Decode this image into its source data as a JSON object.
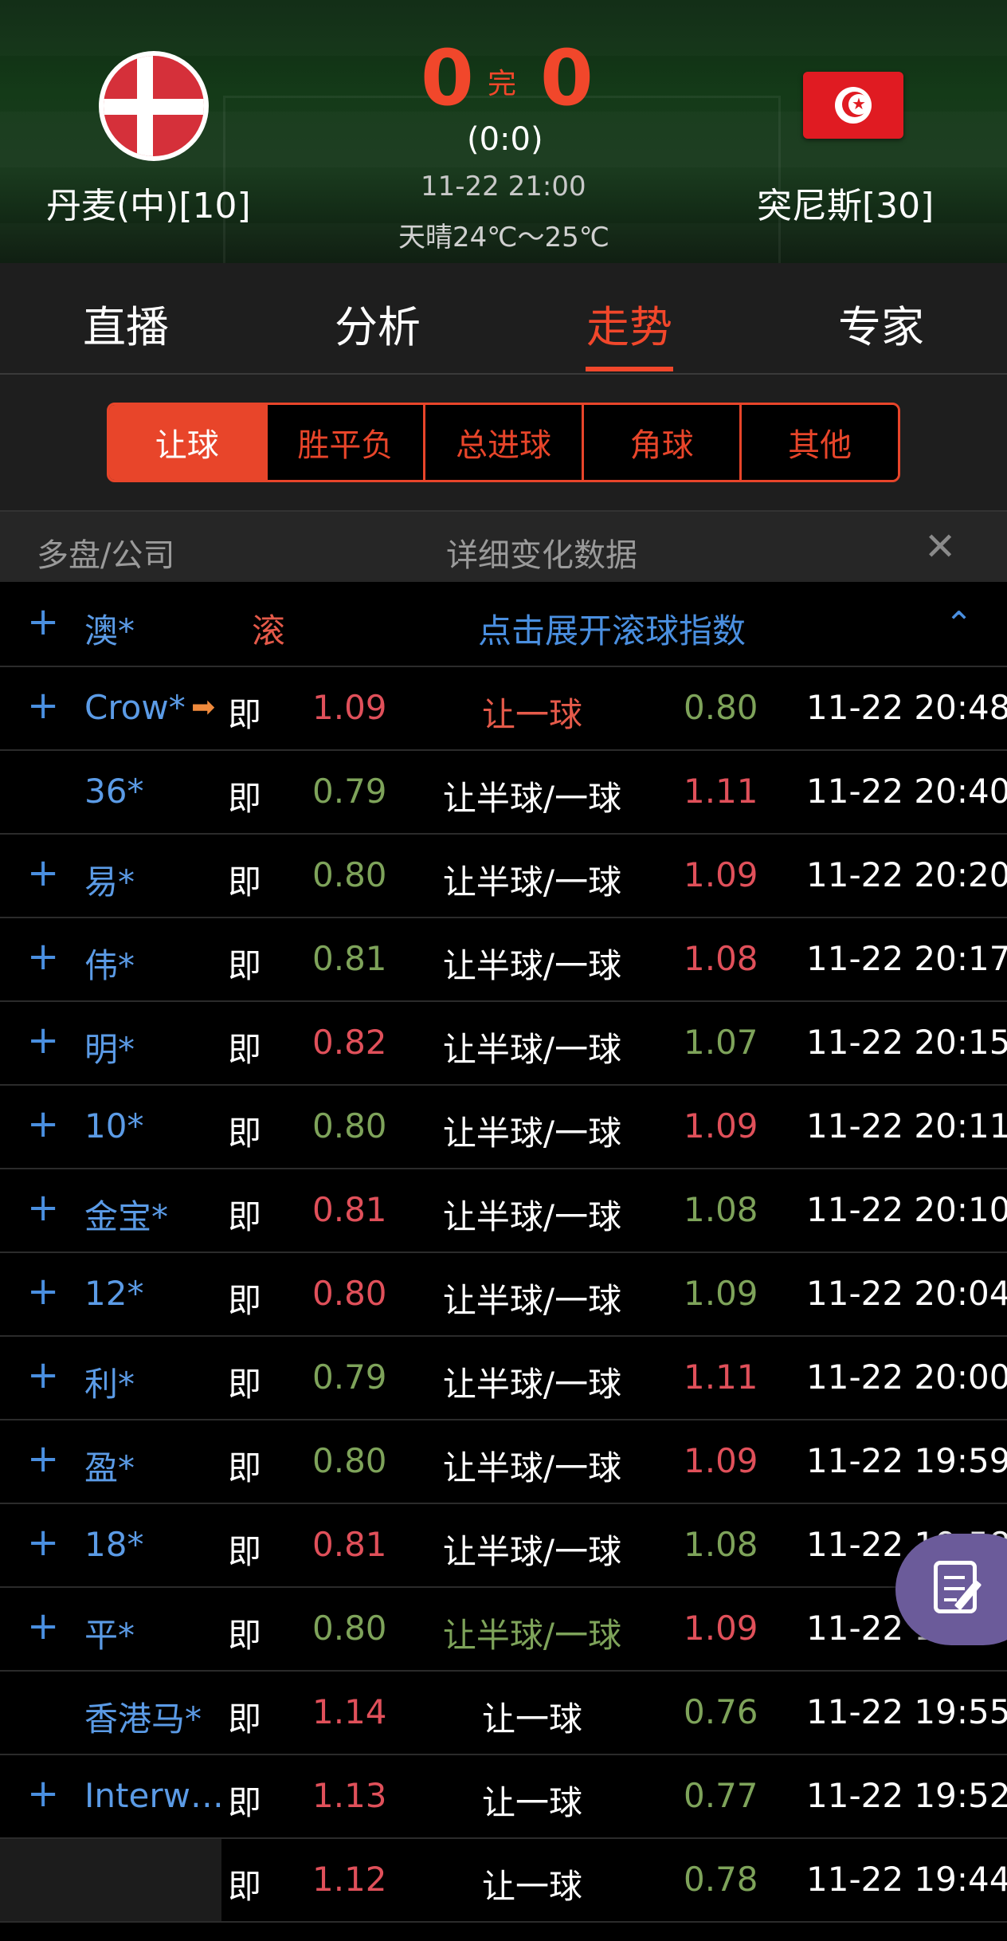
{
  "match": {
    "home_team": "丹麦(中)[10]",
    "away_team": "突尼斯[30]",
    "home_score": "0",
    "away_score": "0",
    "status": "完",
    "halftime": "(0:0)",
    "datetime": "11-22 21:00",
    "weather": "天晴24℃～25℃"
  },
  "tabs": [
    "直播",
    "分析",
    "走势",
    "专家"
  ],
  "active_tab": "走势",
  "filters": [
    "让球",
    "胜平负",
    "总进球",
    "角球",
    "其他"
  ],
  "active_filter": "让球",
  "table_header": {
    "company": "多盘/公司",
    "detail": "详细变化数据",
    "close": "✕"
  },
  "live_row": {
    "plus": "+",
    "company": "澳*",
    "live_tag": "滚",
    "expand_text": "点击展开滚球指数",
    "caret": "⌃"
  },
  "rows": [
    {
      "plus": "+",
      "company": "Crow*",
      "arrow": "➡",
      "tag": "即",
      "home": "1.09",
      "home_color": "red",
      "handicap": "让一球",
      "handicap_color": "red",
      "away": "0.80",
      "away_color": "green",
      "time": "11-22 20:48"
    },
    {
      "plus": "",
      "company": "36*",
      "arrow": "",
      "tag": "即",
      "home": "0.79",
      "home_color": "green",
      "handicap": "让半球/一球",
      "handicap_color": "white",
      "away": "1.11",
      "away_color": "red",
      "time": "11-22 20:40"
    },
    {
      "plus": "+",
      "company": "易*",
      "arrow": "",
      "tag": "即",
      "home": "0.80",
      "home_color": "green",
      "handicap": "让半球/一球",
      "handicap_color": "white",
      "away": "1.09",
      "away_color": "red",
      "time": "11-22 20:20"
    },
    {
      "plus": "+",
      "company": "伟*",
      "arrow": "",
      "tag": "即",
      "home": "0.81",
      "home_color": "green",
      "handicap": "让半球/一球",
      "handicap_color": "white",
      "away": "1.08",
      "away_color": "red",
      "time": "11-22 20:17"
    },
    {
      "plus": "+",
      "company": "明*",
      "arrow": "",
      "tag": "即",
      "home": "0.82",
      "home_color": "red",
      "handicap": "让半球/一球",
      "handicap_color": "white",
      "away": "1.07",
      "away_color": "green",
      "time": "11-22 20:15"
    },
    {
      "plus": "+",
      "company": "10*",
      "arrow": "",
      "tag": "即",
      "home": "0.80",
      "home_color": "green",
      "handicap": "让半球/一球",
      "handicap_color": "white",
      "away": "1.09",
      "away_color": "red",
      "time": "11-22 20:11"
    },
    {
      "plus": "+",
      "company": "金宝*",
      "arrow": "",
      "tag": "即",
      "home": "0.81",
      "home_color": "red",
      "handicap": "让半球/一球",
      "handicap_color": "white",
      "away": "1.08",
      "away_color": "green",
      "time": "11-22 20:10"
    },
    {
      "plus": "+",
      "company": "12*",
      "arrow": "",
      "tag": "即",
      "home": "0.80",
      "home_color": "red",
      "handicap": "让半球/一球",
      "handicap_color": "white",
      "away": "1.09",
      "away_color": "green",
      "time": "11-22 20:04"
    },
    {
      "plus": "+",
      "company": "利*",
      "arrow": "",
      "tag": "即",
      "home": "0.79",
      "home_color": "green",
      "handicap": "让半球/一球",
      "handicap_color": "white",
      "away": "1.11",
      "away_color": "red",
      "time": "11-22 20:00"
    },
    {
      "plus": "+",
      "company": "盈*",
      "arrow": "",
      "tag": "即",
      "home": "0.80",
      "home_color": "green",
      "handicap": "让半球/一球",
      "handicap_color": "white",
      "away": "1.09",
      "away_color": "red",
      "time": "11-22 19:59"
    },
    {
      "plus": "+",
      "company": "18*",
      "arrow": "",
      "tag": "即",
      "home": "0.81",
      "home_color": "red",
      "handicap": "让半球/一球",
      "handicap_color": "white",
      "away": "1.08",
      "away_color": "green",
      "time": "11-22 19:58"
    },
    {
      "plus": "+",
      "company": "平*",
      "arrow": "",
      "tag": "即",
      "home": "0.80",
      "home_color": "green",
      "handicap": "让半球/一球",
      "handicap_color": "green",
      "away": "1.09",
      "away_color": "red",
      "time": "11-22 19:56"
    },
    {
      "plus": "",
      "company": "香港马*",
      "arrow": "",
      "tag": "即",
      "home": "1.14",
      "home_color": "red",
      "handicap": "让一球",
      "handicap_color": "white",
      "away": "0.76",
      "away_color": "green",
      "time": "11-22 19:55"
    },
    {
      "plus": "+",
      "company": "Interw…",
      "arrow": "",
      "tag": "即",
      "home": "1.13",
      "home_color": "red",
      "handicap": "让一球",
      "handicap_color": "white",
      "away": "0.77",
      "away_color": "green",
      "time": "11-22 19:52"
    },
    {
      "plus": "",
      "company": "",
      "arrow": "",
      "tag": "即",
      "home": "1.12",
      "home_color": "red",
      "handicap": "让一球",
      "handicap_color": "white",
      "away": "0.78",
      "away_color": "green",
      "time": "11-22 19:44"
    }
  ],
  "colors": {
    "accent": "#f1472b",
    "odds_red": "#e0505a",
    "odds_green": "#7ea35a",
    "company_blue": "#5b9be6",
    "float_button": "#6b5b9a"
  },
  "float_button_icon": "edit-note-icon"
}
